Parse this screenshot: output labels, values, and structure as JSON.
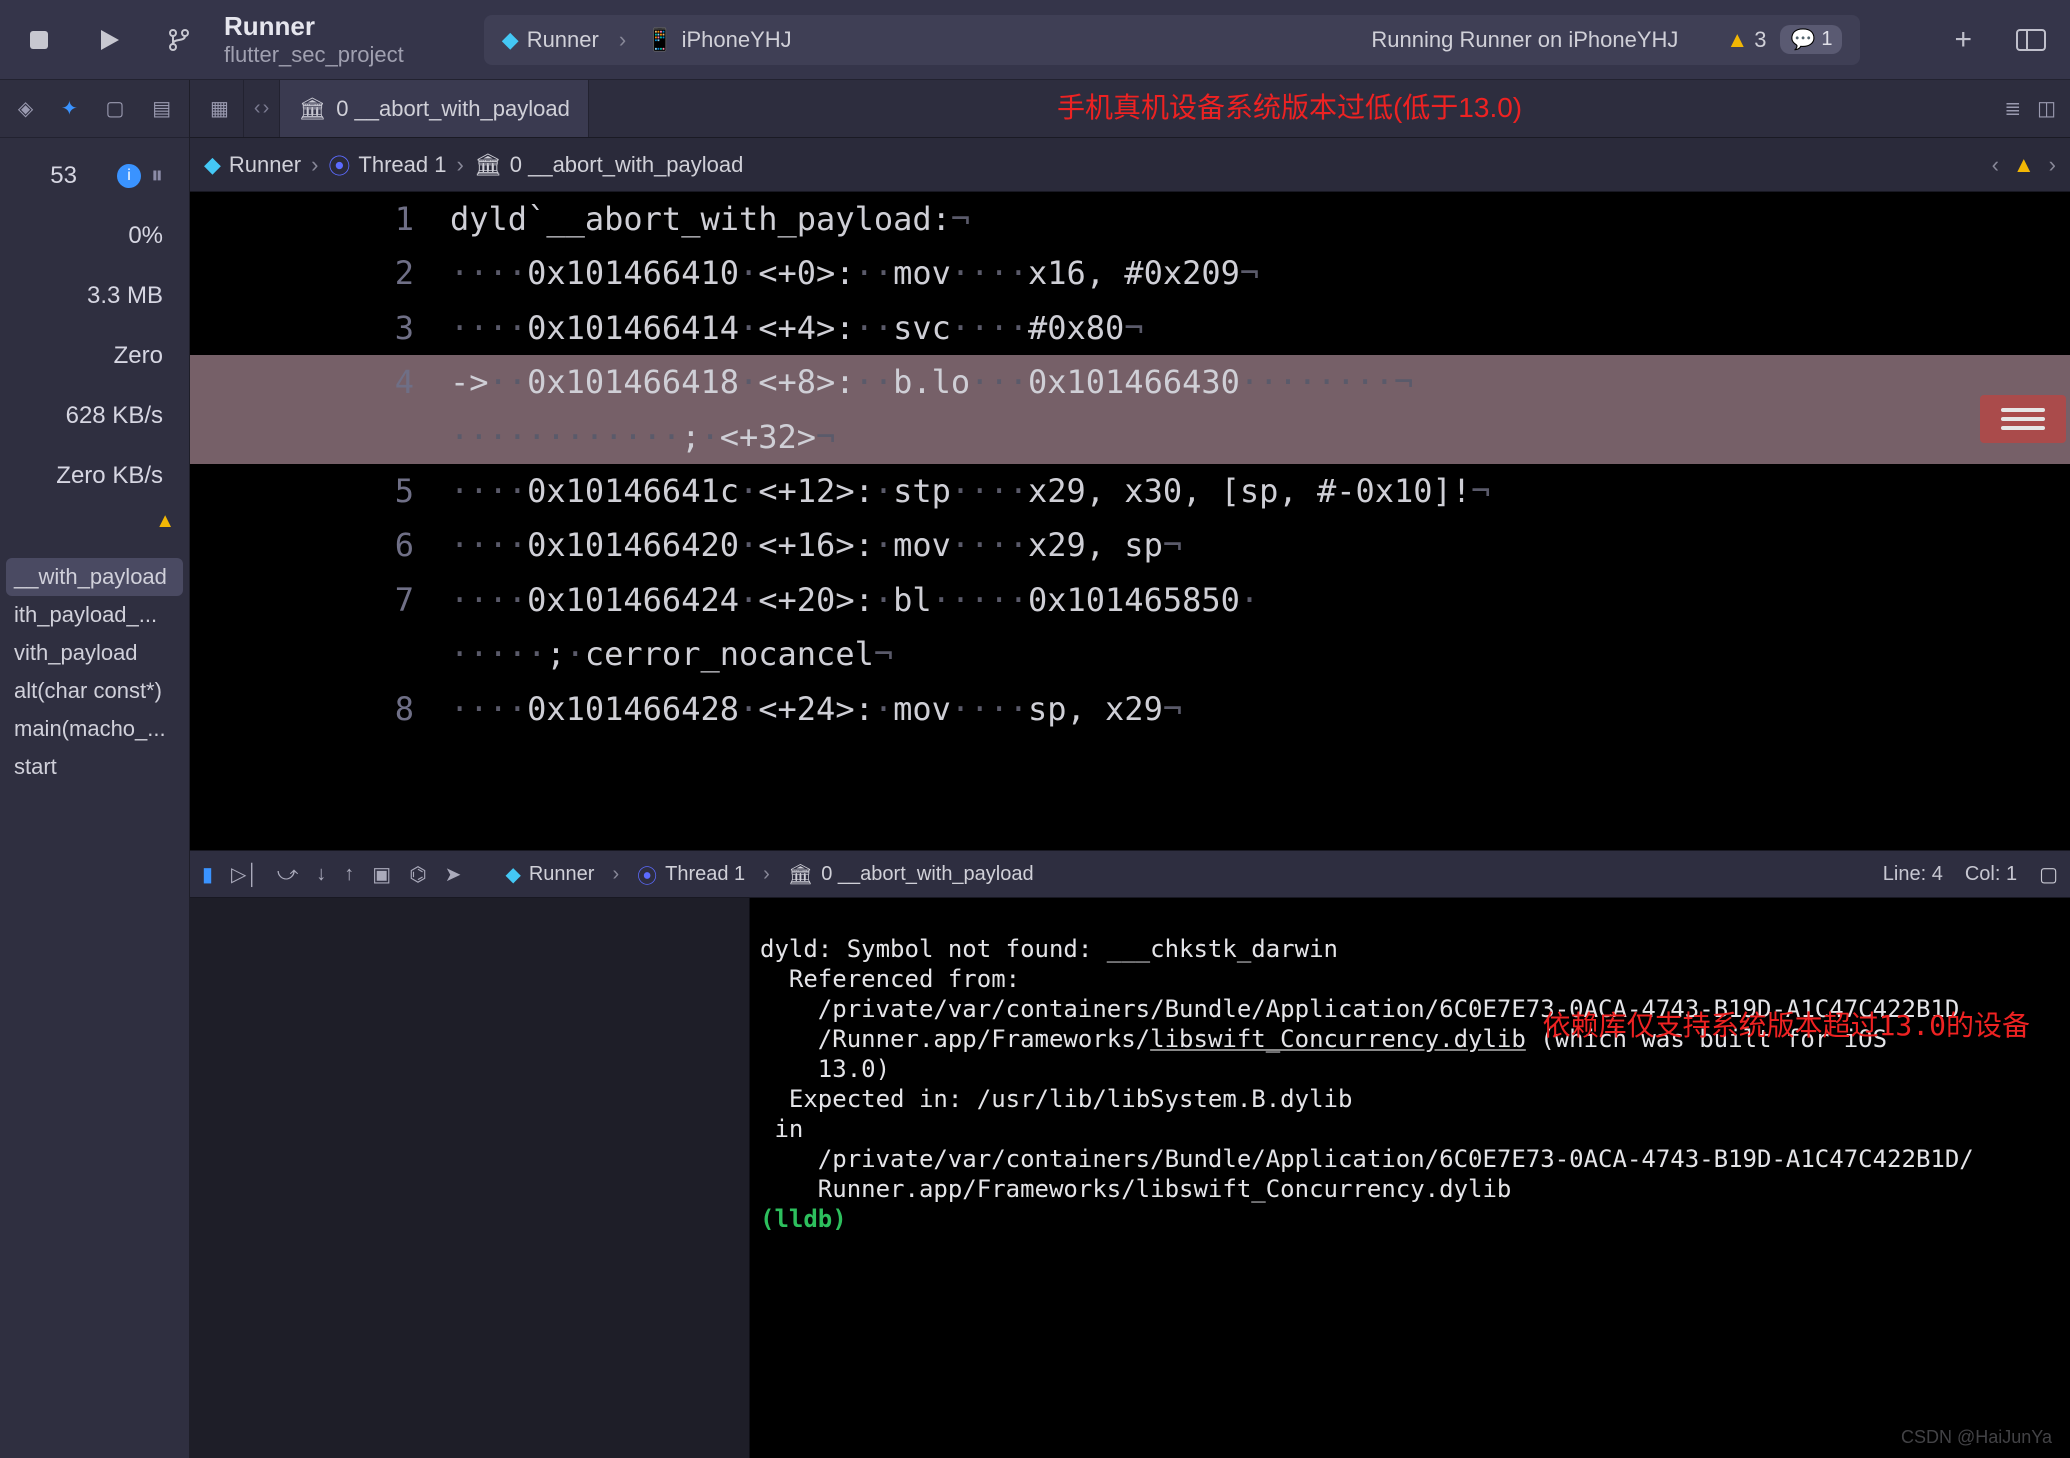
{
  "topbar": {
    "title": "Runner",
    "subtitle": "flutter_sec_project",
    "center": {
      "scheme_icon": "flutter",
      "scheme": "Runner",
      "device_icon": "phone",
      "device": "iPhoneYHJ",
      "status": "Running Runner on iPhoneYHJ",
      "warnings": "3",
      "bubble": "1"
    }
  },
  "sidebar": {
    "top_value": "53",
    "metrics": [
      "0%",
      "3.3 MB",
      "Zero",
      "628 KB/s",
      "Zero KB/s"
    ],
    "stack": [
      "__with_payload",
      "ith_payload_...",
      "vith_payload",
      "alt(char const*)",
      "main(macho_...",
      "start"
    ],
    "selected_stack_index": 0
  },
  "tab": {
    "label": "0 __abort_with_payload"
  },
  "overlay_top": "手机真机设备系统版本过低(低于13.0)",
  "breadcrumb": {
    "a_icon": "flutter",
    "a": "Runner",
    "b_icon": "thread",
    "b": "Thread 1",
    "c_icon": "bank",
    "c": "0 __abort_with_payload"
  },
  "editor": {
    "lines": [
      {
        "n": "1",
        "text": "dyld`__abort_with_payload:¬"
      },
      {
        "n": "2",
        "text": "····0x101466410·<+0>:··mov····x16, #0x209¬"
      },
      {
        "n": "3",
        "text": "····0x101466414·<+4>:··svc····#0x80¬"
      },
      {
        "n": "4",
        "text": "->··0x101466418·<+8>:··b.lo···0x101466430········¬\n············;·<+32>¬",
        "hl": true
      },
      {
        "n": "5",
        "text": "····0x10146641c·<+12>:·stp····x29, x30, [sp, #-0x10]!¬"
      },
      {
        "n": "6",
        "text": "····0x101466420·<+16>:·mov····x29, sp¬"
      },
      {
        "n": "7",
        "text": "····0x101466424·<+20>:·bl·····0x101465850·\n·····;·cerror_nocancel¬"
      },
      {
        "n": "8",
        "text": "····0x101466428·<+24>:·mov····sp, x29¬"
      }
    ]
  },
  "debugbar": {
    "crumb_a_icon": "flutter",
    "crumb_a": "Runner",
    "crumb_b_icon": "thread",
    "crumb_b": "Thread 1",
    "crumb_c_icon": "bank",
    "crumb_c": "0 __abort_with_payload",
    "line": "Line: 4",
    "col": "Col: 1"
  },
  "console": {
    "l1": "dyld: Symbol not found: ___chkstk_darwin",
    "l2": "  Referenced from:",
    "l3a": "    /private/var/containers/Bundle/Application/6C0E7E73-0ACA-4743-B19D-A1C47C422B1D",
    "l3b": "    /Runner.app/Frameworks/",
    "l3u": "libswift_Concurrency.dylib",
    "l3c": " (which was built for iOS",
    "l3d": "    13.0)",
    "l4": "  Expected in: /usr/lib/libSystem.B.dylib",
    "l5": " in",
    "l6": "    /private/var/containers/Bundle/Application/6C0E7E73-0ACA-4743-B19D-A1C47C422B1D/",
    "l7": "    Runner.app/Frameworks/libswift_Concurrency.dylib",
    "prompt": "(lldb)"
  },
  "overlay_bottom": "依赖库仅支持系统版本超过13.0的设备",
  "watermark": "CSDN @HaiJunYa"
}
